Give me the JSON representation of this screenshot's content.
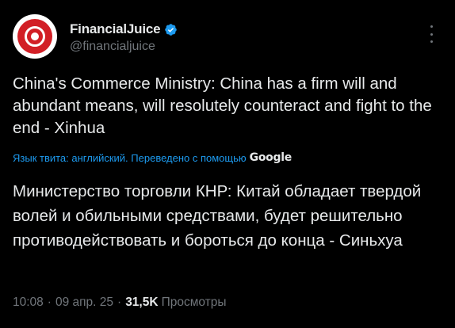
{
  "author": {
    "display_name": "FinancialJuice",
    "handle": "@financialjuice",
    "verified": true,
    "accent_color": "#1d9bf0",
    "avatar_color": "#d21f26"
  },
  "tweet": {
    "text": "China's Commerce Ministry: China has a firm will and abundant means, will resolutely counteract and fight to the end - Xinhua",
    "translation_notice": "Язык твита: английский. Переведено с помощью",
    "translation_provider": "Google",
    "translated_text": "Министерство торговли КНР: Китай обладает твердой волей и обильными средствами, будет решительно противодействовать и бороться до конца - Синьхуа"
  },
  "meta": {
    "time": "10:08",
    "date": "09 апр. 25",
    "separator": "·",
    "views_count": "31,5K",
    "views_label": "Просмотры"
  },
  "icons": {
    "verified": "verified-badge-icon",
    "more": "more-options-icon"
  }
}
